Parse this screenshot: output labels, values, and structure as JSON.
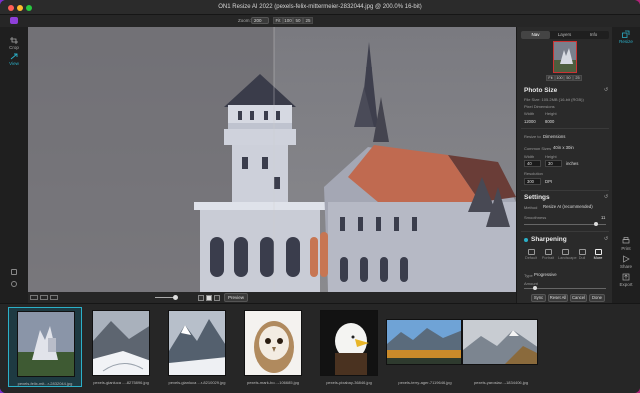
{
  "window": {
    "title": "ON1 Resize AI 2022 (pexels-felix-mittermeier-2832044.jpg @ 200.0% 16-bit)"
  },
  "toolbar": {
    "zoom_label": "Zoom:",
    "zoom_value": "200",
    "zoom_buttons": [
      "Fit",
      "100",
      "50",
      "25"
    ]
  },
  "left_tools": [
    {
      "name": "crop",
      "label": "Crop"
    },
    {
      "name": "view",
      "label": "View"
    }
  ],
  "canvas_footer": {
    "preview_label": "Preview"
  },
  "panel": {
    "tabs": [
      "Nav",
      "Layers",
      "Info"
    ],
    "active_tab": "Nav",
    "fit_buttons": [
      "Fit",
      "100",
      "50",
      "25"
    ],
    "photo_size": {
      "title": "Photo Size",
      "file_size": "File Size: 105.2MB (16-bit (RGB))",
      "pixel_dimensions_label": "Pixel Dimensions",
      "width_label": "Width",
      "height_label": "Height",
      "width_px": "12000",
      "height_px": "8000",
      "resize_to_label": "Resize to",
      "resize_to_value": "Dimensions",
      "common_sizes_label": "Common Sizes",
      "common_sizes_value": "40in x 30in",
      "width2_label": "Width",
      "height2_label": "Height",
      "width_in": "40",
      "height_in": "30",
      "unit": "inches",
      "resolution_label": "Resolution",
      "resolution_value": "300",
      "resolution_unit": "DPI"
    },
    "settings": {
      "title": "Settings",
      "method_label": "Method",
      "method_value": "Resize AI (recommended)",
      "smoothness_label": "Smoothness",
      "smoothness_value": "11"
    },
    "sharpening": {
      "title": "Sharpening",
      "modes": [
        "Default",
        "Portrait",
        "Landscape",
        "Dull",
        "More"
      ],
      "active_mode": "More",
      "type_label": "Type",
      "type_value": "Progressive",
      "amount_label": "Amount"
    },
    "actions": [
      "Sync",
      "Reset All",
      "Cancel",
      "Done"
    ]
  },
  "right_tools": [
    {
      "name": "resize",
      "label": "Resize"
    },
    {
      "name": "print",
      "label": "Print"
    },
    {
      "name": "share",
      "label": "Share"
    },
    {
      "name": "export",
      "label": "Export"
    }
  ],
  "filmstrip": [
    {
      "caption": "pexels-felix-mit...r-2832044.jpg",
      "selected": true
    },
    {
      "caption": "pexels-gianluca ...-8275896.jpg",
      "selected": false
    },
    {
      "caption": "pexels-gianluca ...r-8210029.jpg",
      "selected": false
    },
    {
      "caption": "pexels-mark-bo...-106685.jpg",
      "selected": false
    },
    {
      "caption": "pexels-pixabay-36846.jpg",
      "selected": false
    },
    {
      "caption": "pexels-terry-ager-7119646.jpg",
      "selected": false
    },
    {
      "caption": "pexels-yaroslav...-1834406.jpg",
      "selected": false
    }
  ],
  "colors": {
    "accent": "#2bb0c8",
    "window_bg": "#232323",
    "panel_bg": "#2a2a2a"
  }
}
